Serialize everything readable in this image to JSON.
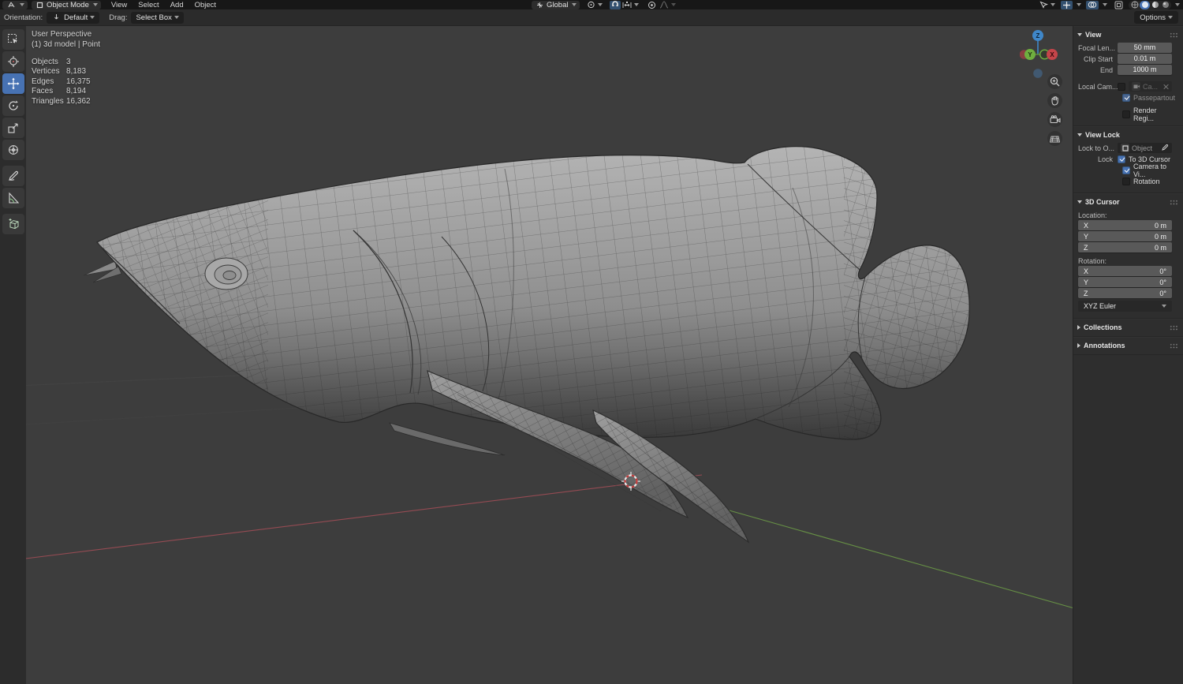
{
  "header": {
    "mode": "Object Mode",
    "menus": {
      "view": "View",
      "select": "Select",
      "add": "Add",
      "object": "Object"
    },
    "orientation_value": "Global",
    "options_label": "Options",
    "tool_row": {
      "orientation_label": "Orientation:",
      "orientation_preset": "Default",
      "drag_label": "Drag:",
      "drag_value": "Select Box"
    }
  },
  "overlay": {
    "view_label": "User Perspective",
    "context_label": "(1) 3d model | Point",
    "stats": [
      {
        "label": "Objects",
        "value": "3"
      },
      {
        "label": "Vertices",
        "value": "8,183"
      },
      {
        "label": "Edges",
        "value": "16,375"
      },
      {
        "label": "Faces",
        "value": "8,194"
      },
      {
        "label": "Triangles",
        "value": "16,362"
      }
    ]
  },
  "gizmo": {
    "x": "X",
    "y": "Y",
    "z": "Z"
  },
  "panel": {
    "view": {
      "title": "View",
      "focal_label": "Focal Len...",
      "focal_value": "50 mm",
      "clip_start_label": "Clip Start",
      "clip_start_value": "0.01 m",
      "clip_end_label": "End",
      "clip_end_value": "1000 m",
      "local_cam_label": "Local Cam...",
      "local_cam_value": "Ca...",
      "passepartout_label": "Passepartout",
      "render_region_label": "Render Regi..."
    },
    "view_lock": {
      "title": "View Lock",
      "lock_to_label": "Lock to O...",
      "lock_to_value": "Object",
      "lock_label": "Lock",
      "cb_cursor": "To 3D Cursor",
      "cb_camera": "Camera to Vi...",
      "cb_rotation": "Rotation"
    },
    "cursor": {
      "title": "3D Cursor",
      "location_label": "Location:",
      "rotation_label": "Rotation:",
      "x": "X",
      "y": "Y",
      "z": "Z",
      "loc_x": "0 m",
      "loc_y": "0 m",
      "loc_z": "0 m",
      "rot_x": "0°",
      "rot_y": "0°",
      "rot_z": "0°",
      "euler": "XYZ Euler"
    },
    "collections_title": "Collections",
    "annotations_title": "Annotations"
  },
  "colors": {
    "accent": "#4772b3",
    "axis_x": "#9e4d55",
    "axis_y": "#6d9e47"
  }
}
